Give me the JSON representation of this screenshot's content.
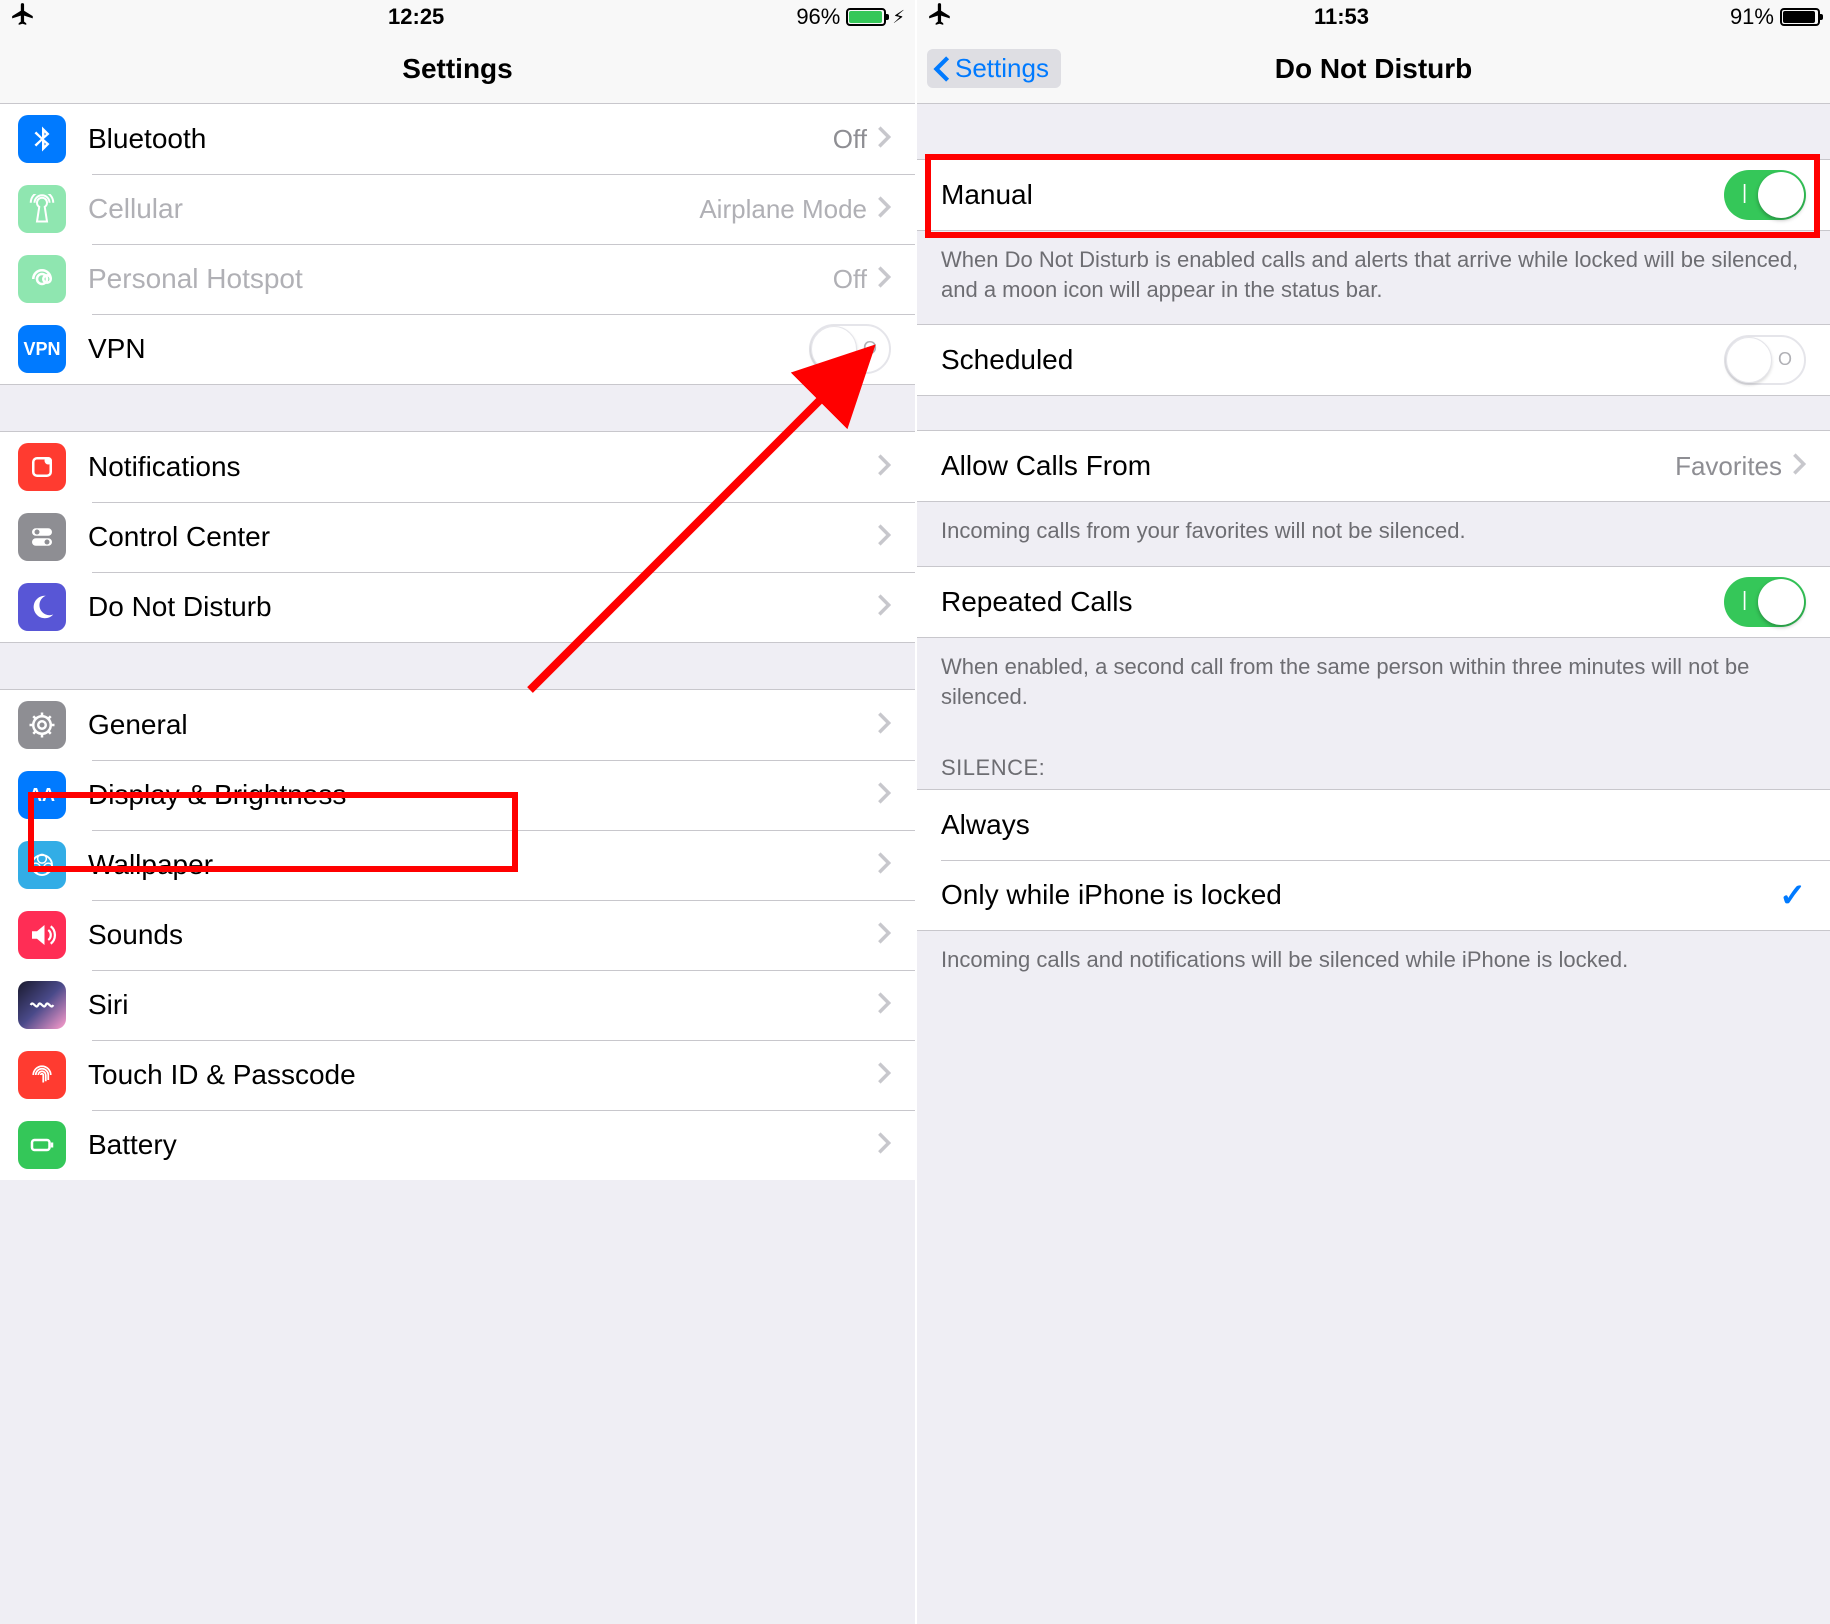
{
  "left": {
    "status": {
      "time": "12:25",
      "battery_pct": "96%",
      "battery_fill": 96,
      "charging": true
    },
    "nav_title": "Settings",
    "rows": {
      "bluetooth": {
        "label": "Bluetooth",
        "value": "Off"
      },
      "cellular": {
        "label": "Cellular",
        "value": "Airplane Mode"
      },
      "hotspot": {
        "label": "Personal Hotspot",
        "value": "Off"
      },
      "vpn": {
        "label": "VPN",
        "icon_text": "VPN"
      },
      "notifications": {
        "label": "Notifications"
      },
      "control_center": {
        "label": "Control Center"
      },
      "dnd": {
        "label": "Do Not Disturb"
      },
      "general": {
        "label": "General"
      },
      "display": {
        "label": "Display & Brightness"
      },
      "wallpaper": {
        "label": "Wallpaper"
      },
      "sounds": {
        "label": "Sounds"
      },
      "siri": {
        "label": "Siri"
      },
      "touchid": {
        "label": "Touch ID & Passcode"
      },
      "battery": {
        "label": "Battery"
      }
    }
  },
  "right": {
    "status": {
      "time": "11:53",
      "battery_pct": "91%",
      "battery_fill": 91
    },
    "nav_back": "Settings",
    "nav_title": "Do Not Disturb",
    "manual": {
      "label": "Manual",
      "on": true
    },
    "manual_footer": "When Do Not Disturb is enabled calls and alerts that arrive while locked will be silenced, and a moon icon will appear in the status bar.",
    "scheduled": {
      "label": "Scheduled",
      "on": false
    },
    "allow_calls": {
      "label": "Allow Calls From",
      "value": "Favorites"
    },
    "allow_calls_footer": "Incoming calls from your favorites will not be silenced.",
    "repeated": {
      "label": "Repeated Calls",
      "on": true
    },
    "repeated_footer": "When enabled, a second call from the same person within three minutes will not be silenced.",
    "silence_header": "SILENCE:",
    "silence_always": "Always",
    "silence_locked": "Only while iPhone is locked",
    "silence_footer": "Incoming calls and notifications will be silenced while iPhone is locked."
  }
}
